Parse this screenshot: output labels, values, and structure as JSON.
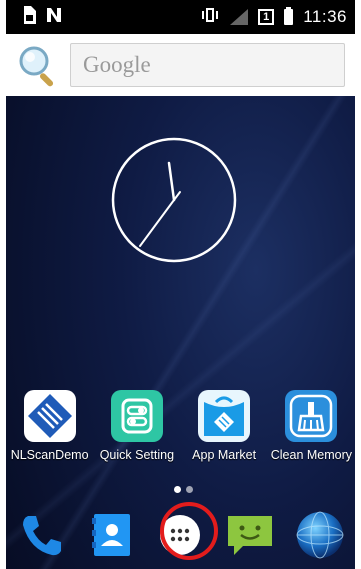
{
  "status_bar": {
    "time": "11:36",
    "sim_slot": "1"
  },
  "search": {
    "placeholder": "Google"
  },
  "apps": [
    {
      "label": "NLScanDemo",
      "icon": "nlscandemo-icon"
    },
    {
      "label": "Quick Setting",
      "icon": "quick-setting-icon"
    },
    {
      "label": "App Market",
      "icon": "app-market-icon"
    },
    {
      "label": "Clean Memory",
      "icon": "clean-memory-icon"
    }
  ],
  "dock": [
    {
      "icon": "phone-icon"
    },
    {
      "icon": "contacts-icon"
    },
    {
      "icon": "app-drawer-icon"
    },
    {
      "icon": "messaging-icon"
    },
    {
      "icon": "browser-globe-icon"
    }
  ],
  "colors": {
    "wallpaper": "#0f1b44",
    "highlight": "#e31c1c",
    "quick_setting": "#2ec6a4",
    "app_market": "#1a9be6",
    "clean_memory": "#2b8fdc",
    "messaging": "#8dc63f"
  }
}
